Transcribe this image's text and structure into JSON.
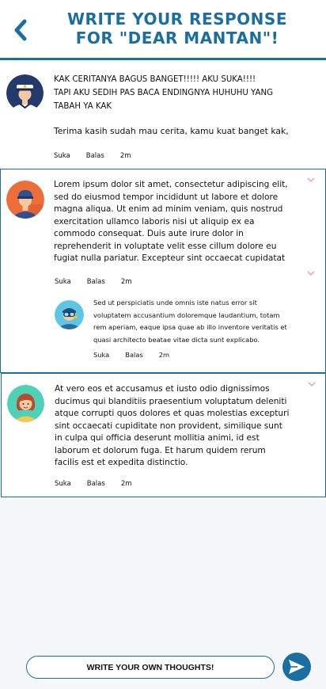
{
  "header": {
    "title_line1": "WRITE YOUR RESPONSE",
    "title_line2": "FOR \"DEAR MANTAN\"!",
    "back_icon": "chevron-left-icon",
    "accent_color": "#1b6fa0"
  },
  "comments": [
    {
      "avatar_icon": "captain-avatar",
      "line1": "KAK CERITANYA BAGUS BANGET!!!!! AKU SUKA!!!!",
      "line2": "TAPI AKU SEDIH PAS BACA ENDINGNYA HUHUHU YANG TABAH YA KAK",
      "line3": "Terima kasih sudah mau cerita, kamu kuat banget kak,",
      "like": "Suka",
      "reply": "Balas",
      "time": "2m"
    },
    {
      "avatar_icon": "worker-avatar",
      "text": "Lorem ipsum dolor sit amet, consectetur adipiscing elit, sed do eiusmod tempor incididunt ut labore et dolore magna aliqua. Ut enim ad minim veniam, quis nostrud exercitation ullamco laboris nisi ut aliquip ex ea commodo consequat. Duis aute irure dolor in reprehenderit in voluptate velit esse cillum dolore eu fugiat nulla pariatur. Excepteur sint occaecat cupidatat",
      "like": "Suka",
      "reply": "Balas",
      "time": "2m",
      "replies": [
        {
          "avatar_icon": "diver-avatar",
          "text": "Sed ut perspiciatis unde omnis iste natus error sit voluptatem accusantium doloremque laudantium, totam rem aperiam, eaque ipsa quae ab illo inventore veritatis et quasi architecto beatae vitae dicta sunt explicabo.",
          "like": "Suka",
          "reply": "Balas",
          "time": "2m"
        }
      ]
    },
    {
      "avatar_icon": "woman-avatar",
      "text": "At vero eos et accusamus et iusto odio dignissimos ducimus qui blanditiis praesentium voluptatum deleniti atque corrupti quos dolores et quas molestias excepturi sint occaecati cupiditate non provident, similique sunt in culpa qui officia deserunt mollitia animi, id est laborum et dolorum fuga. Et harum quidem rerum facilis est et expedita distinctio.",
      "like": "Suka",
      "reply": "Balas",
      "time": "2m"
    }
  ],
  "compose": {
    "placeholder": "WRITE YOUR OWN THOUGHTS!",
    "send_icon": "send-icon"
  }
}
